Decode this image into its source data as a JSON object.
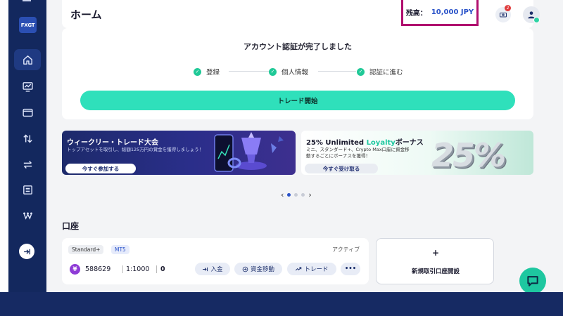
{
  "brand": {
    "logo_text": "FXGT"
  },
  "header": {
    "title": "ホーム",
    "balance_label": "残高：",
    "balance_value": "10,000 JPY",
    "notification_count": "2"
  },
  "sidebar": {
    "items": [
      {
        "icon": "home-icon",
        "active": true
      },
      {
        "icon": "chart-icon",
        "active": false
      },
      {
        "icon": "wallet-icon",
        "active": false
      },
      {
        "icon": "transfer-icon",
        "active": false
      },
      {
        "icon": "exchange-icon",
        "active": false
      },
      {
        "icon": "document-icon",
        "active": false
      },
      {
        "icon": "network-icon",
        "active": false
      }
    ],
    "collapse_icon": "collapse-arrow-icon"
  },
  "verification": {
    "title": "アカウント認証が完了しました",
    "steps": [
      "登録",
      "個人情報",
      "認証に進む"
    ],
    "trade_button": "トレード開始"
  },
  "banners": [
    {
      "title": "ウィークリー・トレード大会",
      "description": "トップアセットを取引し、総額125万円の賞金を獲得しましょう！",
      "button": "今すぐ参加する"
    },
    {
      "title_prefix": "25% Unlimited ",
      "title_accent": "Loyalty",
      "title_suffix": "ボーナス",
      "description_line1": "ミニ、スタンダード+、Crypto Max口座に資金移",
      "description_line2": "動するごとにボーナスを獲得！",
      "button": "今すぐ受け取る",
      "art_text": "25%"
    }
  ],
  "carousel": {
    "prev": "‹",
    "next": "›",
    "active_index": 0,
    "count": 3
  },
  "accounts": {
    "section_title": "口座",
    "card": {
      "type_tag": "Standard+",
      "platform_tag": "MT5",
      "status": "アクティブ",
      "currency_symbol": "¥",
      "number": "588629",
      "leverage": "1:1000",
      "balance": "0",
      "actions": {
        "deposit": "入金",
        "transfer": "資金移動",
        "trade": "トレード",
        "more": "•••"
      }
    },
    "new_account": {
      "plus": "+",
      "label": "新規取引口座開設"
    }
  },
  "colors": {
    "sidebar": "#13285e",
    "accent_teal": "#2fe0bb",
    "balance_blue": "#2851c8",
    "highlight_border": "#b00f6e"
  }
}
